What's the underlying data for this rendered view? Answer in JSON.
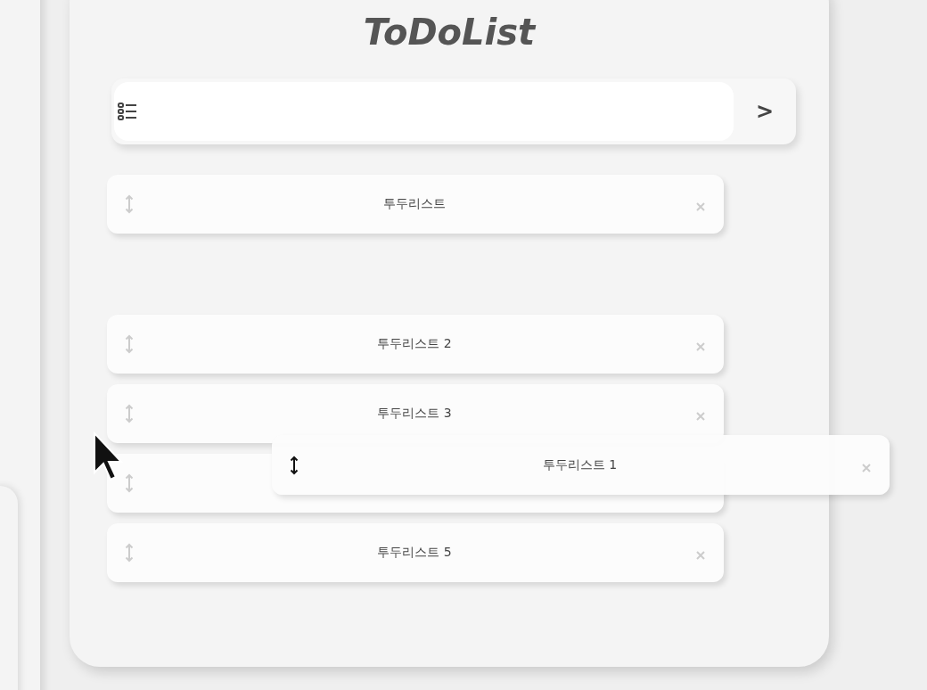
{
  "title": "ToDoList",
  "input": {
    "button": ">"
  },
  "items": [
    {
      "kind": "item",
      "label": "투두리스트"
    },
    {
      "kind": "drop-slot"
    },
    {
      "kind": "item",
      "label": "투두리스트 2"
    },
    {
      "kind": "item",
      "label": "투두리스트 3"
    },
    {
      "kind": "covered"
    },
    {
      "kind": "item",
      "label": "투두리스트 5"
    }
  ],
  "dragged": {
    "label": "투두리스트 1"
  }
}
